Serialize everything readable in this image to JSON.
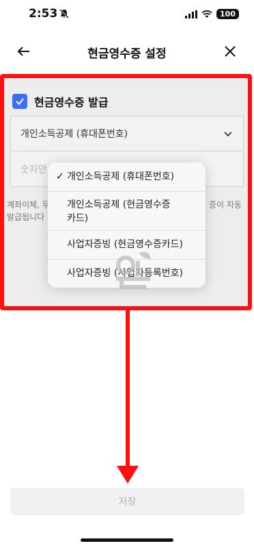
{
  "status_bar": {
    "time": "2:53",
    "battery": "100"
  },
  "header": {
    "title": "현금영수증 설정"
  },
  "form": {
    "issue_checkbox_label": "현금영수증 발급",
    "type_select_value": "개인소득공제 (휴대폰번호)",
    "number_input_placeholder": "숫자만 입력해주세요",
    "info_text_left": "계좌이체, 무",
    "info_text_left_2": "발급됩니다",
    "info_text_right": "증이 자동"
  },
  "dropdown": {
    "selected_index": 0,
    "options": [
      "개인소득공제 (휴대폰번호)",
      "개인소득공제 (현금영수증 카드)",
      "사업자증빙 (현금영수증카드)",
      "사업자증빙 (사업자등록번호)"
    ],
    "option_2_line1": "개인소득공제 (현금영수증",
    "option_2_line2": "카드)"
  },
  "footer": {
    "save_label": "저장"
  },
  "colors": {
    "accent": "#3b6ef5",
    "highlight": "#ff1010"
  },
  "icons": [
    "bell-off-icon",
    "signal-icon",
    "wifi-icon",
    "back-arrow-icon",
    "close-icon",
    "check-icon",
    "chevron-down-icon",
    "checkmark-icon",
    "watermark-logo"
  ]
}
